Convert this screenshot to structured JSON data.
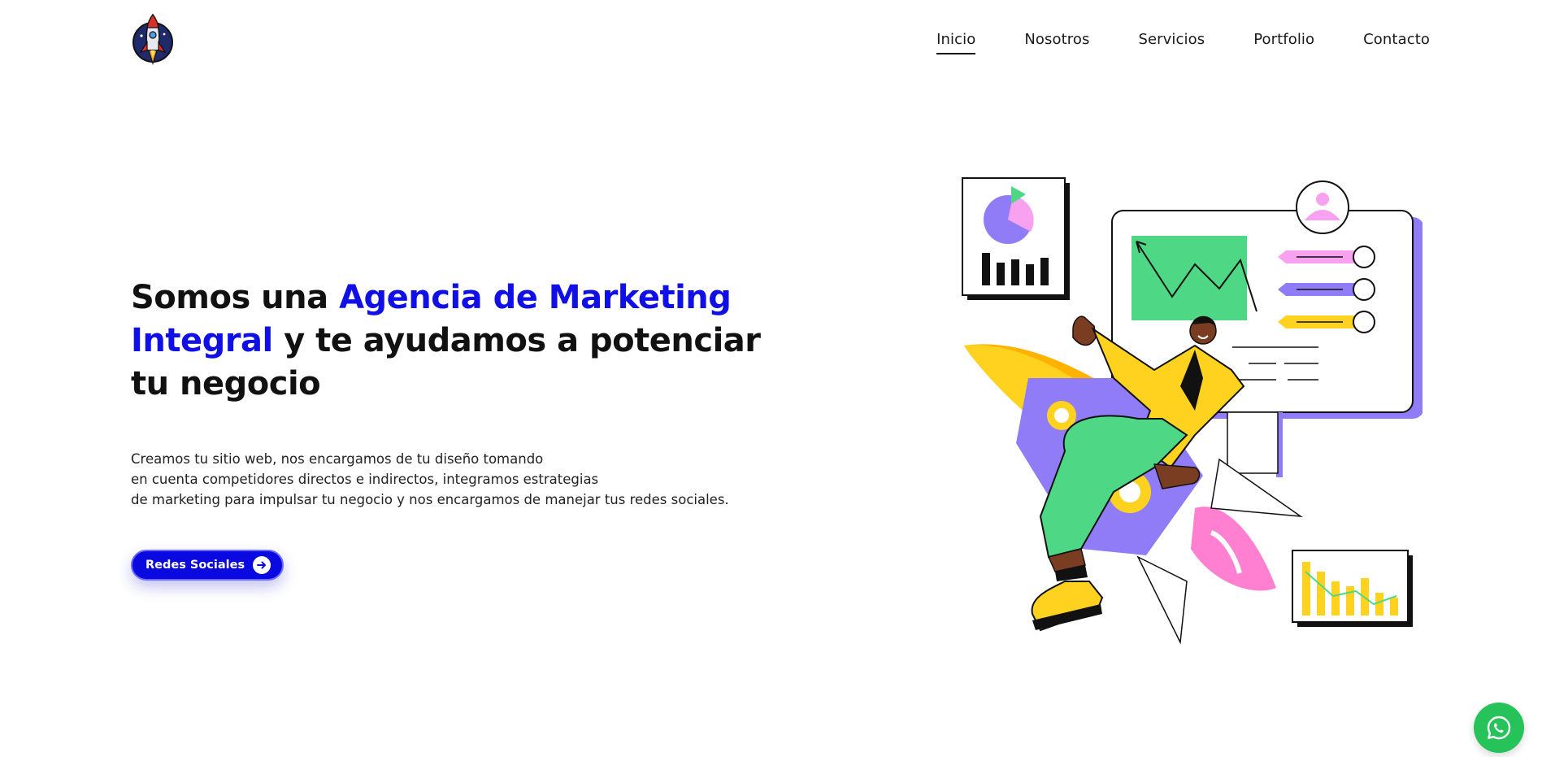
{
  "brand": {
    "logo_icon": "rocket-logo-icon"
  },
  "nav": {
    "items": [
      {
        "label": "Inicio",
        "active": true
      },
      {
        "label": "Nosotros",
        "active": false
      },
      {
        "label": "Servicios",
        "active": false
      },
      {
        "label": "Portfolio",
        "active": false
      },
      {
        "label": "Contacto",
        "active": false
      }
    ]
  },
  "hero": {
    "title_part1": "Somos una ",
    "title_accent": "Agencia de Marketing Integral",
    "title_part2": " y te ayudamos a potenciar tu negocio",
    "description_lines": [
      "Creamos tu sitio web, nos encargamos de tu diseño tomando",
      "en cuenta competidores directos e indirectos, integramos estrategias",
      "de marketing para impulsar tu negocio y nos encargamos de manejar tus redes sociales."
    ],
    "cta_label": "Redes Sociales",
    "cta_icon": "arrow-right-icon"
  },
  "colors": {
    "accent": "#1010e6",
    "button": "#0a0ae0",
    "whatsapp": "#25c35a"
  },
  "floating": {
    "icon": "whatsapp-icon"
  }
}
